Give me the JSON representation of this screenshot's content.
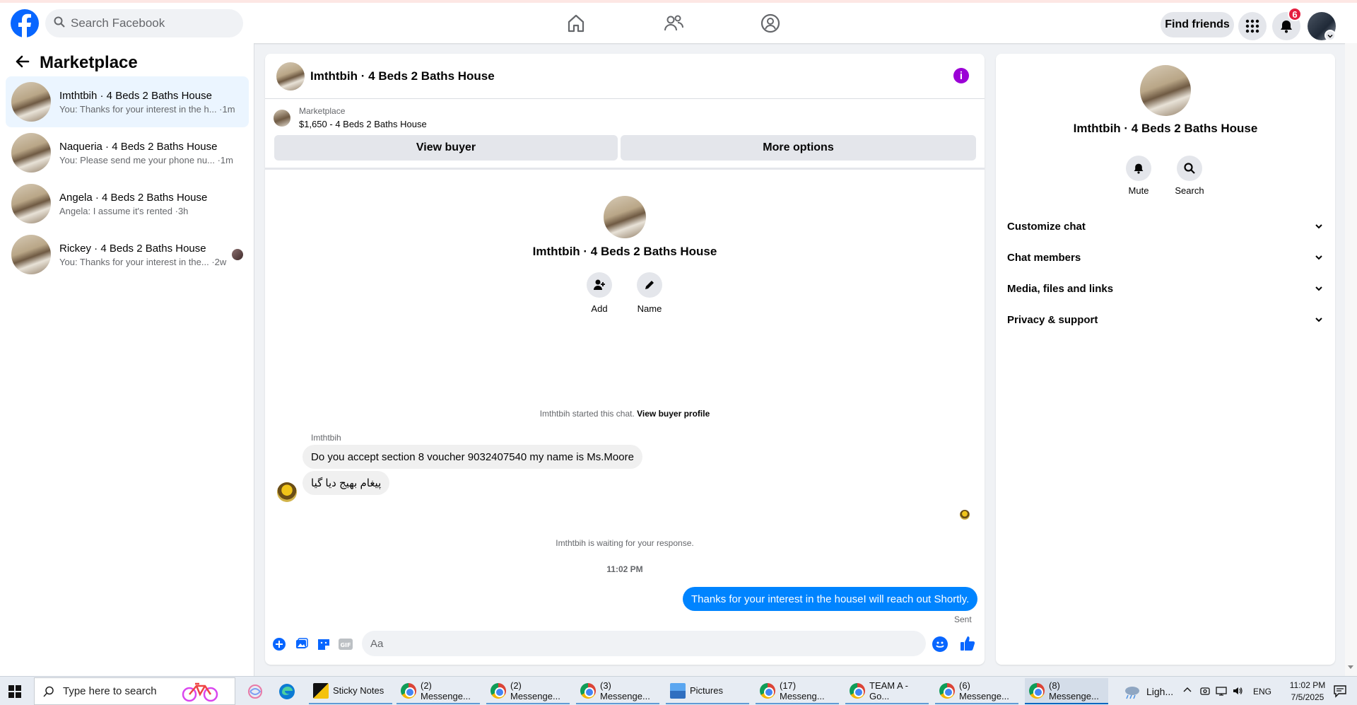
{
  "topbar": {
    "search_placeholder": "Search Facebook",
    "find_friends": "Find friends",
    "notification_count": "6"
  },
  "sidebar": {
    "title": "Marketplace",
    "conversations": [
      {
        "name": "Imthtbih · 4 Beds 2 Baths House",
        "preview": "You: Thanks for your interest in the h... ·1m"
      },
      {
        "name": "Naqueria · 4 Beds 2 Baths House",
        "preview": "You: Please send me your phone nu... ·1m"
      },
      {
        "name": "Angela · 4 Beds 2 Baths House",
        "preview": "Angela: I assume it's rented ·3h"
      },
      {
        "name": "Rickey · 4 Beds 2 Baths House",
        "preview": "You: Thanks for your interest in the... ·2w"
      }
    ]
  },
  "chat": {
    "title": "Imthtbih · 4 Beds 2 Baths House",
    "marketplace_label": "Marketplace",
    "listing": "$1,650 - 4 Beds 2 Baths House",
    "view_buyer": "View buyer",
    "more_options": "More options",
    "intro_title": "Imthtbih · 4 Beds 2 Baths House",
    "add_label": "Add",
    "name_label": "Name",
    "started_text": "Imthtbih started this chat.",
    "view_buyer_profile": "View buyer profile",
    "sender_name": "Imthtbih",
    "messages_in": [
      "Do you accept section 8 voucher 9032407540 my name is Ms.Moore",
      "پیغام بھیج دیا گیا"
    ],
    "waiting_text": "Imthtbih is waiting for your response.",
    "timestamp": "11:02 PM",
    "message_out": "Thanks for your interest in the houseI will reach out Shortly.",
    "sent_label": "Sent",
    "composer_placeholder": "Aa"
  },
  "details": {
    "title": "Imthtbih · 4 Beds 2 Baths House",
    "mute_label": "Mute",
    "search_label": "Search",
    "sections": [
      "Customize chat",
      "Chat members",
      "Media, files and links",
      "Privacy & support"
    ]
  },
  "taskbar": {
    "search_placeholder": "Type here to search",
    "apps": [
      "Sticky Notes",
      "(2) Messenge...",
      "(2) Messenge...",
      "(3) Messenge...",
      "Pictures",
      "(17) Messeng...",
      "TEAM A - Go...",
      "(6) Messenge...",
      "(8) Messenge..."
    ],
    "weather": "Ligh...",
    "language": "ENG",
    "time": "11:02 PM",
    "date": "7/5/2025"
  },
  "colors": {
    "brand_blue": "#0866ff",
    "outgoing_bubble": "#0084ff",
    "info_purple": "#9b00d6",
    "badge_red": "#e41e3f"
  }
}
